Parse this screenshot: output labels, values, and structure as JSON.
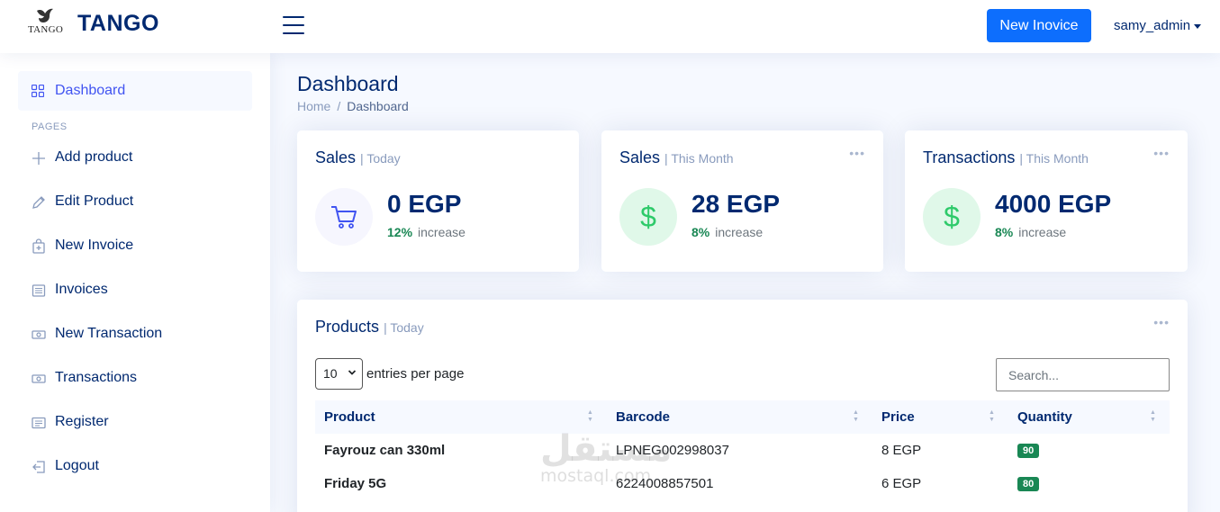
{
  "header": {
    "logo_text": "TANGO",
    "brand": "TANGO",
    "new_invoice_label": "New Inovice",
    "username": "samy_admin"
  },
  "sidebar": {
    "active_item": "Dashboard",
    "section_heading": "PAGES",
    "items": [
      {
        "label": "Add product",
        "icon": "plus-icon"
      },
      {
        "label": "Edit Product",
        "icon": "pencil-icon"
      },
      {
        "label": "New Invoice",
        "icon": "bag-plus-icon"
      },
      {
        "label": "Invoices",
        "icon": "list-icon"
      },
      {
        "label": "New Transaction",
        "icon": "cash-icon"
      },
      {
        "label": "Transactions",
        "icon": "cash-icon"
      },
      {
        "label": "Register",
        "icon": "card-list-icon"
      },
      {
        "label": "Logout",
        "icon": "box-arrow-left-icon"
      }
    ]
  },
  "page": {
    "title": "Dashboard",
    "breadcrumb": [
      "Home",
      "Dashboard"
    ]
  },
  "cards": [
    {
      "title": "Sales",
      "period": "| Today",
      "value": "0 EGP",
      "percent": "12%",
      "change": "increase",
      "icon": "cart-icon"
    },
    {
      "title": "Sales",
      "period": "| This Month",
      "value": "28 EGP",
      "percent": "8%",
      "change": "increase",
      "icon": "dollar-icon"
    },
    {
      "title": "Transactions",
      "period": "| This Month",
      "value": "4000 EGP",
      "percent": "8%",
      "change": "increase",
      "icon": "dollar-icon"
    }
  ],
  "products": {
    "title": "Products",
    "period": "| Today",
    "per_page": "10",
    "per_page_label": "entries per page",
    "search_placeholder": "Search...",
    "columns": [
      "Product",
      "Barcode",
      "Price",
      "Quantity"
    ],
    "rows": [
      {
        "product": "Fayrouz can 330ml",
        "barcode": "LPNEG002998037",
        "price": "8 EGP",
        "quantity": "90"
      },
      {
        "product": "Friday 5G",
        "barcode": "6224008857501",
        "price": "6 EGP",
        "quantity": "80"
      }
    ]
  },
  "watermark": {
    "arabic": "مستقل",
    "latin": "mostaql.com"
  },
  "colors": {
    "primary": "#4154f1",
    "navy": "#012970",
    "button": "#0d6efd",
    "success": "#198754",
    "muted": "#899bbd"
  }
}
